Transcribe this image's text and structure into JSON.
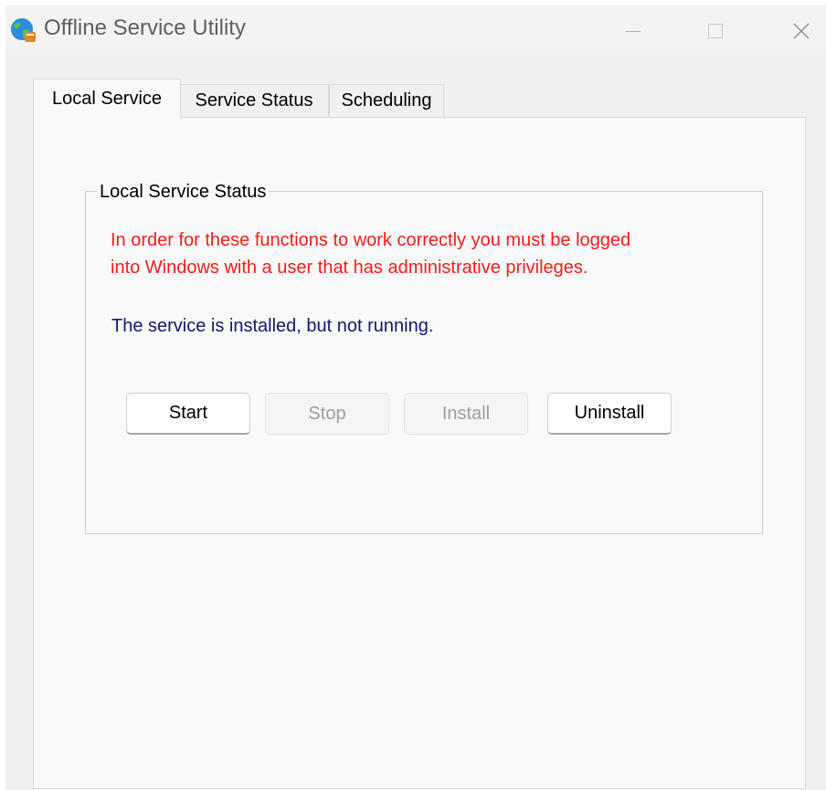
{
  "window": {
    "title": "Offline Service Utility",
    "icon": "globe-app-icon",
    "controls": [
      "minimize",
      "maximize",
      "close"
    ]
  },
  "tabs": [
    {
      "label": "Local Service",
      "active": true
    },
    {
      "label": "Service Status",
      "active": false
    },
    {
      "label": "Scheduling",
      "active": false
    }
  ],
  "local_service": {
    "group_title": "Local Service Status",
    "warning_line1": "In order for these functions to work correctly you must be logged",
    "warning_line2": "into Windows with a user that has administrative privileges.",
    "status_text": "The service is installed, but not running.",
    "buttons": {
      "start": {
        "label": "Start",
        "enabled": true
      },
      "stop": {
        "label": "Stop",
        "enabled": false
      },
      "install": {
        "label": "Install",
        "enabled": false
      },
      "uninstall": {
        "label": "Uninstall",
        "enabled": true
      }
    }
  },
  "colors": {
    "warning": "#ff1a1a",
    "status": "#161670",
    "disabled_text": "#9e9e9e"
  }
}
